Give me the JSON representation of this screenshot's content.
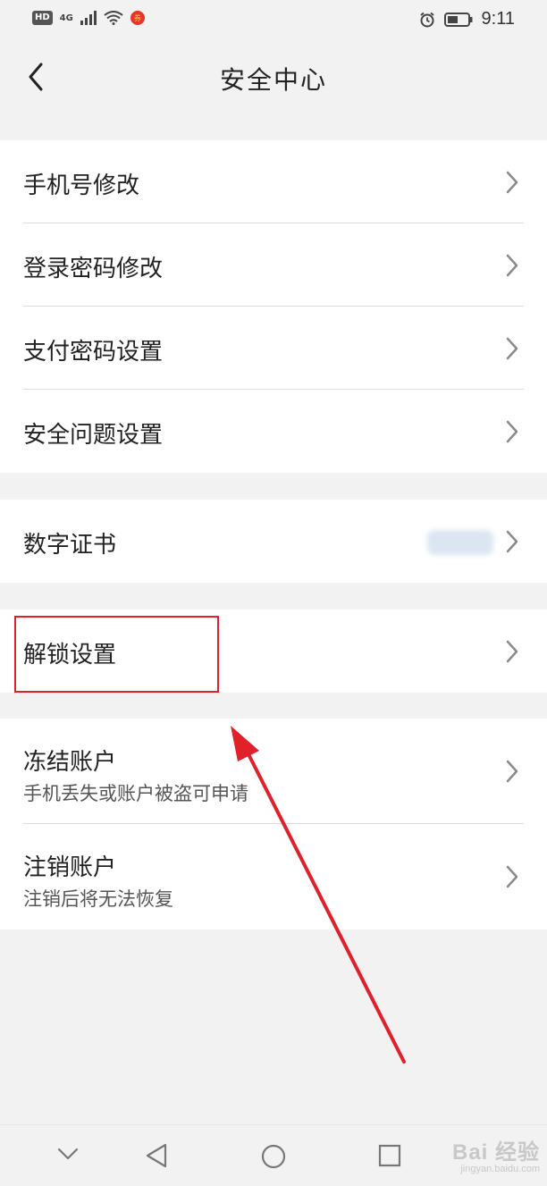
{
  "status_bar": {
    "left_badge": "HD",
    "network": "4G",
    "time": "9:11",
    "icons": [
      "signal-icon",
      "wifi-icon",
      "notification-icon",
      "alarm-icon",
      "battery-icon"
    ]
  },
  "header": {
    "title": "安全中心",
    "back_icon": "chevron-left-icon"
  },
  "groups": {
    "account": {
      "items": [
        {
          "label": "手机号修改"
        },
        {
          "label": "登录密码修改"
        },
        {
          "label": "支付密码设置"
        },
        {
          "label": "安全问题设置"
        }
      ]
    },
    "certificate": {
      "label": "数字证书"
    },
    "unlock": {
      "label": "解锁设置"
    },
    "danger": {
      "items": [
        {
          "label": "冻结账户",
          "sub": "手机丢失或账户被盗可申请"
        },
        {
          "label": "注销账户",
          "sub": "注销后将无法恢复"
        }
      ]
    }
  },
  "annotation": {
    "color": "#e0202a"
  },
  "system_nav": {
    "buttons": [
      "collapse-icon",
      "back-triangle-icon",
      "home-circle-icon",
      "recents-square-icon"
    ]
  },
  "watermark": {
    "main": "Bai 经验",
    "sub": "jingyan.baidu.com"
  },
  "colors": {
    "background": "#f2f2f2",
    "card": "#ffffff",
    "divider": "#dddddd",
    "annotation": "#e0202a"
  }
}
